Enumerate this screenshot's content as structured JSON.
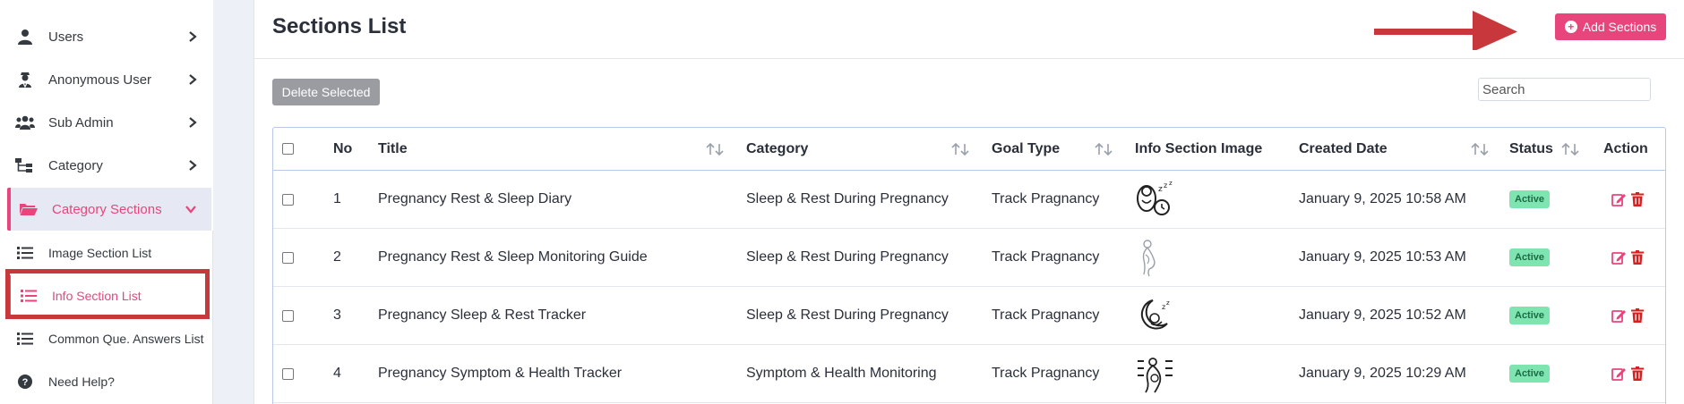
{
  "sidebar": {
    "items": [
      {
        "label": "Users",
        "icon": "user-icon"
      },
      {
        "label": "Anonymous User",
        "icon": "user-secret-icon"
      },
      {
        "label": "Sub Admin",
        "icon": "users-icon"
      },
      {
        "label": "Category",
        "icon": "sitemap-icon"
      },
      {
        "label": "Category Sections",
        "icon": "folder-open-icon"
      }
    ],
    "submenu": [
      {
        "label": "Image Section List",
        "icon": "list-icon"
      },
      {
        "label": "Info Section List",
        "icon": "list-icon"
      },
      {
        "label": "Common Que. Answers List",
        "icon": "list-icon"
      },
      {
        "label": "Need Help?",
        "icon": "question-circle-icon"
      }
    ]
  },
  "header": {
    "title": "Sections List",
    "add_label": "Add Sections"
  },
  "toolbar": {
    "delete_label": "Delete Selected",
    "search_placeholder": "Search"
  },
  "table": {
    "columns": [
      "No",
      "Title",
      "Category",
      "Goal Type",
      "Info Section Image",
      "Created Date",
      "Status",
      "Action"
    ],
    "rows": [
      {
        "no": "1",
        "title": "Pregnancy Rest & Sleep Diary",
        "category": "Sleep & Rest During Pregnancy",
        "goal": "Track Pragnancy",
        "image": "sleeping-baby-alarm-icon",
        "date": "January 9, 2025 10:58 AM",
        "status": "Active"
      },
      {
        "no": "2",
        "title": "Pregnancy Rest & Sleep Monitoring Guide",
        "category": "Sleep & Rest During Pregnancy",
        "goal": "Track Pragnancy",
        "image": "pregnant-woman-icon",
        "date": "January 9, 2025 10:53 AM",
        "status": "Active"
      },
      {
        "no": "3",
        "title": "Pregnancy Sleep & Rest Tracker",
        "category": "Sleep & Rest During Pregnancy",
        "goal": "Track Pragnancy",
        "image": "moon-sleep-icon",
        "date": "January 9, 2025 10:52 AM",
        "status": "Active"
      },
      {
        "no": "4",
        "title": "Pregnancy Symptom & Health Tracker",
        "category": "Symptom & Health Monitoring",
        "goal": "Track Pragnancy",
        "image": "pregnancy-checklist-icon",
        "date": "January 9, 2025 10:29 AM",
        "status": "Active"
      }
    ]
  },
  "colors": {
    "accent": "#e8457c",
    "status_active": "#7ee5b1",
    "annotation_red": "#c8373b"
  }
}
